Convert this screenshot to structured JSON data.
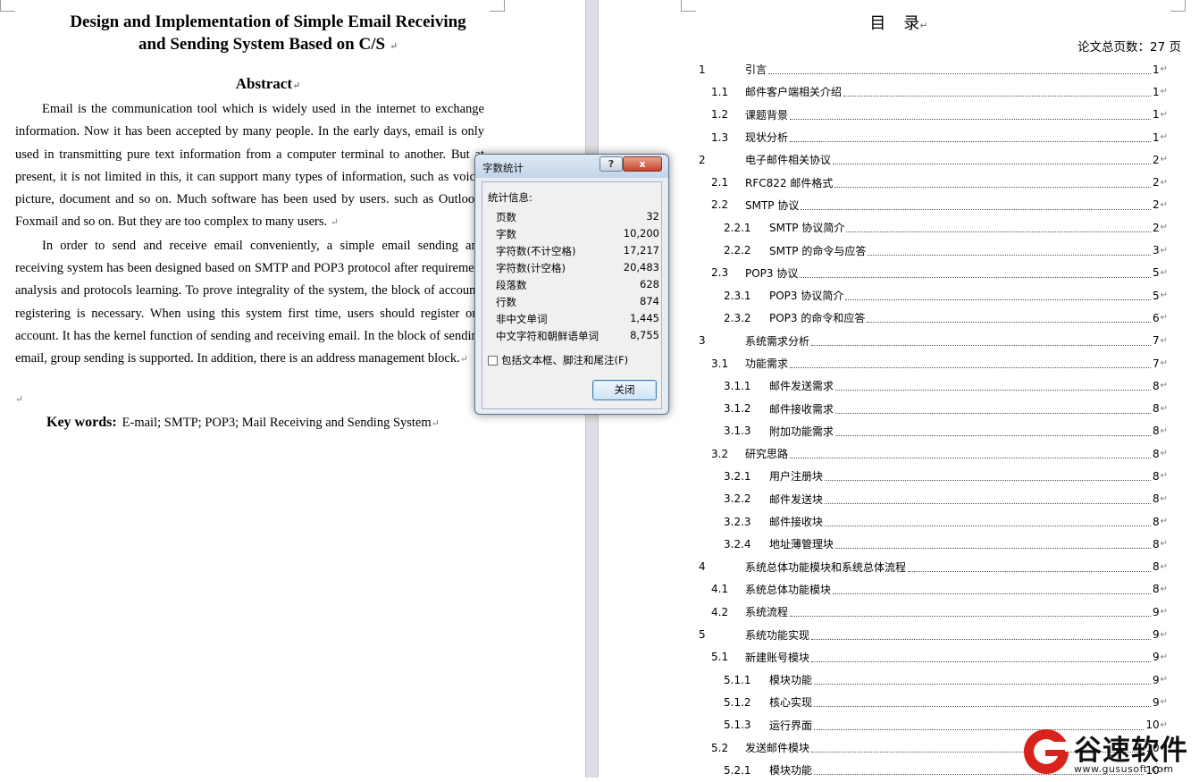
{
  "left_page": {
    "title_line1": "Design and Implementation of Simple Email Receiving",
    "title_line2": "and Sending System Based on C/S",
    "abstract_heading": "Abstract",
    "paragraph1": "Email is the communication tool which is widely used in the internet to exchange information. Now it has been accepted by many people. In the early days, email is only used in transmitting pure text information from a computer terminal to another. But at present, it is not limited in this, it can support many types of information, such as voice, picture, document and so on. Much software has been used by users. such as Outlook, Foxmail and so on. But they are too complex to many users.",
    "paragraph2": "In order to send and receive email conveniently, a simple email sending and receiving system has been designed based on SMTP and POP3 protocol after requirement analysis and protocols learning. To prove integrality of the system, the block of accounts registering is necessary. When using this system first time, users should register one account. It has the kernel function of sending and receiving email. In the block of sending email, group sending is supported. In addition, there is an address management block.",
    "keywords_label": "Key words:",
    "keywords": "E-mail; SMTP; POP3; Mail Receiving and Sending System",
    "para_mark": "↵"
  },
  "right_page": {
    "toc_title_a": "目",
    "toc_title_b": "录",
    "total_pages": "论文总页数：27 页",
    "entries": [
      {
        "num": "1",
        "label": "引言",
        "page": "1"
      },
      {
        "num": "1.1",
        "label": "邮件客户端相关介绍",
        "page": "1"
      },
      {
        "num": "1.2",
        "label": "课题背景",
        "page": "1"
      },
      {
        "num": "1.3",
        "label": "现状分析",
        "page": "1"
      },
      {
        "num": "2",
        "label": "电子邮件相关协议",
        "page": "2"
      },
      {
        "num": "2.1",
        "label": "RFC822 邮件格式",
        "page": "2"
      },
      {
        "num": "2.2",
        "label": "SMTP 协议",
        "page": "2"
      },
      {
        "num": "2.2.1",
        "label": "SMTP 协议简介",
        "page": "2"
      },
      {
        "num": "2.2.2",
        "label": "SMTP 的命令与应答",
        "page": "3"
      },
      {
        "num": "2.3",
        "label": "POP3 协议",
        "page": "5"
      },
      {
        "num": "2.3.1",
        "label": "POP3 协议简介",
        "page": "5"
      },
      {
        "num": "2.3.2",
        "label": "POP3 的命令和应答",
        "page": "6"
      },
      {
        "num": "3",
        "label": "系统需求分析",
        "page": "7"
      },
      {
        "num": "3.1",
        "label": "功能需求",
        "page": "7"
      },
      {
        "num": "3.1.1",
        "label": "邮件发送需求",
        "page": "8"
      },
      {
        "num": "3.1.2",
        "label": "邮件接收需求",
        "page": "8"
      },
      {
        "num": "3.1.3",
        "label": "附加功能需求",
        "page": "8"
      },
      {
        "num": "3.2",
        "label": "研究思路",
        "page": "8"
      },
      {
        "num": "3.2.1",
        "label": "用户注册块",
        "page": "8"
      },
      {
        "num": "3.2.2",
        "label": "邮件发送块",
        "page": "8"
      },
      {
        "num": "3.2.3",
        "label": "邮件接收块",
        "page": "8"
      },
      {
        "num": "3.2.4",
        "label": "地址薄管理块",
        "page": "8"
      },
      {
        "num": "4",
        "label": "系统总体功能模块和系统总体流程",
        "page": "8"
      },
      {
        "num": "4.1",
        "label": "系统总体功能模块",
        "page": "8"
      },
      {
        "num": "4.2",
        "label": "系统流程",
        "page": "9"
      },
      {
        "num": "5",
        "label": "系统功能实现",
        "page": "9"
      },
      {
        "num": "5.1",
        "label": "新建账号模块",
        "page": "9"
      },
      {
        "num": "5.1.1",
        "label": "模块功能",
        "page": "9"
      },
      {
        "num": "5.1.2",
        "label": "核心实现",
        "page": "9"
      },
      {
        "num": "5.1.3",
        "label": "运行界面",
        "page": "10"
      },
      {
        "num": "5.2",
        "label": "发送邮件模块",
        "page": "10"
      },
      {
        "num": "5.2.1",
        "label": "模块功能",
        "page": "10"
      }
    ]
  },
  "dialog": {
    "title": "字数统计",
    "help_label": "?",
    "close_x_label": "x",
    "group_label": "统计信息:",
    "stats": [
      {
        "name": "页数",
        "value": "32"
      },
      {
        "name": "字数",
        "value": "10,200"
      },
      {
        "name": "字符数(不计空格)",
        "value": "17,217"
      },
      {
        "name": "字符数(计空格)",
        "value": "20,483"
      },
      {
        "name": "段落数",
        "value": "628"
      },
      {
        "name": "行数",
        "value": "874"
      },
      {
        "name": "非中文单词",
        "value": "1,445"
      },
      {
        "name": "中文字符和朝鲜语单词",
        "value": "8,755"
      }
    ],
    "checkbox_label": "包括文本框、脚注和尾注(F)",
    "checkbox_checked": false,
    "close_button_label": "关闭"
  },
  "watermark": {
    "brand": "谷速软件",
    "url": "www.gususoft.com"
  }
}
